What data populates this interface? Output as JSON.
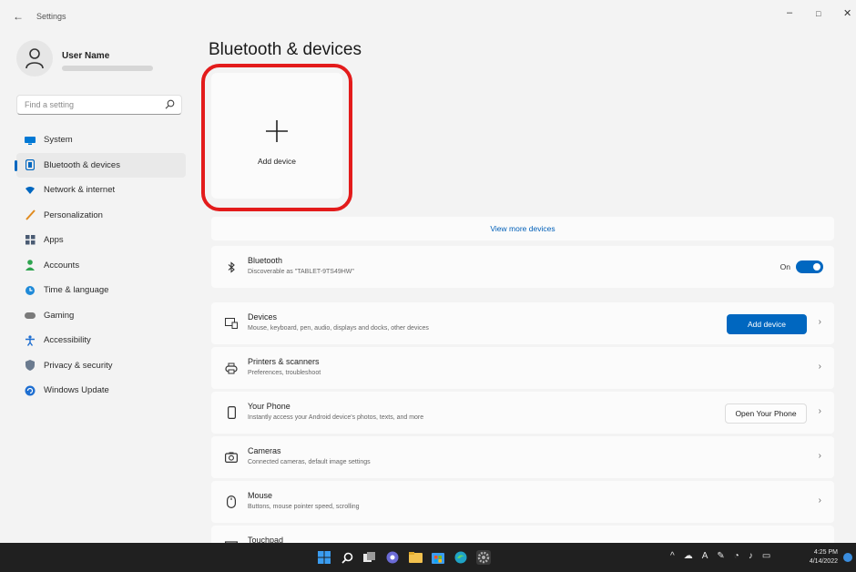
{
  "window": {
    "title": "Settings",
    "back_glyph": "←",
    "minimize_glyph": "–",
    "maximize_glyph": "□",
    "close_glyph": "✕"
  },
  "profile": {
    "user_name": "User Name"
  },
  "search": {
    "placeholder": "Find a setting"
  },
  "sidebar": {
    "items": [
      {
        "label": "System",
        "icon": "monitor-icon",
        "color": "#0078d4"
      },
      {
        "label": "Bluetooth & devices",
        "icon": "bluetooth-icon",
        "color": "#0067c0",
        "active": true
      },
      {
        "label": "Network & internet",
        "icon": "wifi-icon",
        "color": "#0067c0"
      },
      {
        "label": "Personalization",
        "icon": "brush-icon",
        "color": "#e08a1e"
      },
      {
        "label": "Apps",
        "icon": "apps-icon",
        "color": "#4a5b73"
      },
      {
        "label": "Accounts",
        "icon": "person-icon",
        "color": "#2ea44f"
      },
      {
        "label": "Time & language",
        "icon": "globe-clock-icon",
        "color": "#1f8ad8"
      },
      {
        "label": "Gaming",
        "icon": "controller-icon",
        "color": "#7a7a7a"
      },
      {
        "label": "Accessibility",
        "icon": "accessibility-icon",
        "color": "#1f6fd1"
      },
      {
        "label": "Privacy & security",
        "icon": "shield-icon",
        "color": "#6b7b8f"
      },
      {
        "label": "Windows Update",
        "icon": "update-icon",
        "color": "#1f6fd1"
      }
    ]
  },
  "main": {
    "title": "Bluetooth & devices",
    "add_tile": {
      "label": "Add device"
    },
    "view_more": "View more devices",
    "bluetooth": {
      "title": "Bluetooth",
      "subtitle": "Discoverable as \"TABLET-9TS49HW\"",
      "state": "On"
    },
    "rows": [
      {
        "title": "Devices",
        "subtitle": "Mouse, keyboard, pen, audio, displays and docks, other devices",
        "icon": "keyboard-icon",
        "button": "Add device",
        "button_style": "primary"
      },
      {
        "title": "Printers & scanners",
        "subtitle": "Preferences, troubleshoot",
        "icon": "printer-icon"
      },
      {
        "title": "Your Phone",
        "subtitle": "Instantly access your Android device's photos, texts, and more",
        "icon": "phone-icon",
        "button": "Open Your Phone",
        "button_style": "secondary"
      },
      {
        "title": "Cameras",
        "subtitle": "Connected cameras, default image settings",
        "icon": "camera-icon"
      },
      {
        "title": "Mouse",
        "subtitle": "Buttons, mouse pointer speed, scrolling",
        "icon": "mouse-icon"
      }
    ],
    "partial_row": {
      "title": "Touchpad"
    }
  },
  "taskbar": {
    "time": "4:25 PM",
    "date": "4/14/2022",
    "tray_language": "A",
    "accent": "#0078d4"
  }
}
